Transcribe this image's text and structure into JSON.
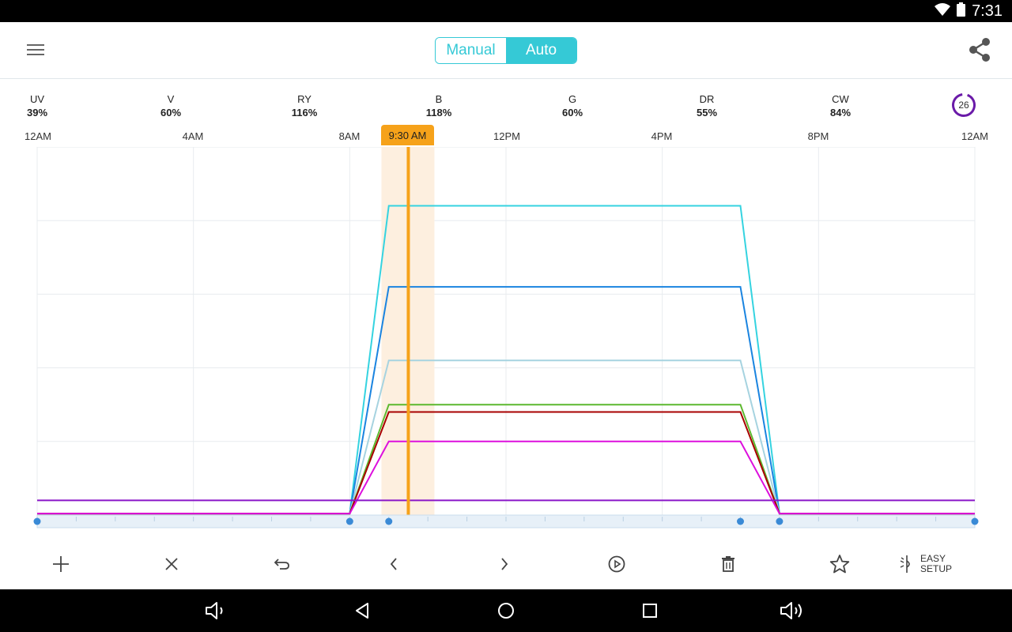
{
  "status_bar": {
    "time": "7:31"
  },
  "app_bar": {
    "mode_toggle": {
      "manual_label": "Manual",
      "auto_label": "Auto",
      "selected": "Auto"
    }
  },
  "channels": [
    {
      "name": "UV",
      "value": "39%"
    },
    {
      "name": "V",
      "value": "60%"
    },
    {
      "name": "RY",
      "value": "116%"
    },
    {
      "name": "B",
      "value": "118%"
    },
    {
      "name": "G",
      "value": "60%"
    },
    {
      "name": "DR",
      "value": "55%"
    },
    {
      "name": "CW",
      "value": "84%"
    }
  ],
  "counter": {
    "value": "26"
  },
  "current_time_label": "9:30 AM",
  "toolbar": {
    "easy_setup_line1": "EASY",
    "easy_setup_line2": "SETUP"
  },
  "colors": {
    "accent": "#35c9d6",
    "now_marker": "#f6a21a",
    "counter_ring": "#6a1aa8"
  },
  "chart_data": {
    "type": "line",
    "x_unit": "hour of day",
    "x_ticks": [
      {
        "hour": 0,
        "label": "12AM"
      },
      {
        "hour": 4,
        "label": "4AM"
      },
      {
        "hour": 8,
        "label": "8AM"
      },
      {
        "hour": 12,
        "label": "12PM"
      },
      {
        "hour": 16,
        "label": "4PM"
      },
      {
        "hour": 20,
        "label": "8PM"
      },
      {
        "hour": 24,
        "label": "12AM"
      }
    ],
    "xlim": [
      0,
      24
    ],
    "ylim": [
      0,
      5
    ],
    "grid": true,
    "current_time_hour": 9.5,
    "control_points_hours": [
      0,
      8,
      9,
      18,
      19,
      24
    ],
    "series": [
      {
        "color": "#35d3e0",
        "x": [
          0,
          8,
          9,
          18,
          19,
          24
        ],
        "y": [
          0.02,
          0.02,
          4.2,
          4.2,
          0.02,
          0.02
        ]
      },
      {
        "color": "#1a84e0",
        "x": [
          0,
          8,
          9,
          18,
          19,
          24
        ],
        "y": [
          0.02,
          0.02,
          3.1,
          3.1,
          0.02,
          0.02
        ]
      },
      {
        "color": "#a6d3e0",
        "x": [
          0,
          8,
          9,
          18,
          19,
          24
        ],
        "y": [
          0.02,
          0.02,
          2.1,
          2.1,
          0.02,
          0.02
        ]
      },
      {
        "color": "#5cb82e",
        "x": [
          0,
          8,
          9,
          18,
          19,
          24
        ],
        "y": [
          0.02,
          0.02,
          1.5,
          1.5,
          0.02,
          0.02
        ]
      },
      {
        "color": "#a80000",
        "x": [
          0,
          8,
          9,
          18,
          19,
          24
        ],
        "y": [
          0.02,
          0.02,
          1.4,
          1.4,
          0.02,
          0.02
        ]
      },
      {
        "color": "#dd10dd",
        "x": [
          0,
          8,
          9,
          18,
          19,
          24
        ],
        "y": [
          0.02,
          0.02,
          1.0,
          1.0,
          0.02,
          0.02
        ]
      },
      {
        "color": "#8a16c8",
        "x": [
          0,
          8,
          9,
          18,
          19,
          24
        ],
        "y": [
          0.2,
          0.2,
          0.2,
          0.2,
          0.2,
          0.2
        ]
      }
    ]
  }
}
